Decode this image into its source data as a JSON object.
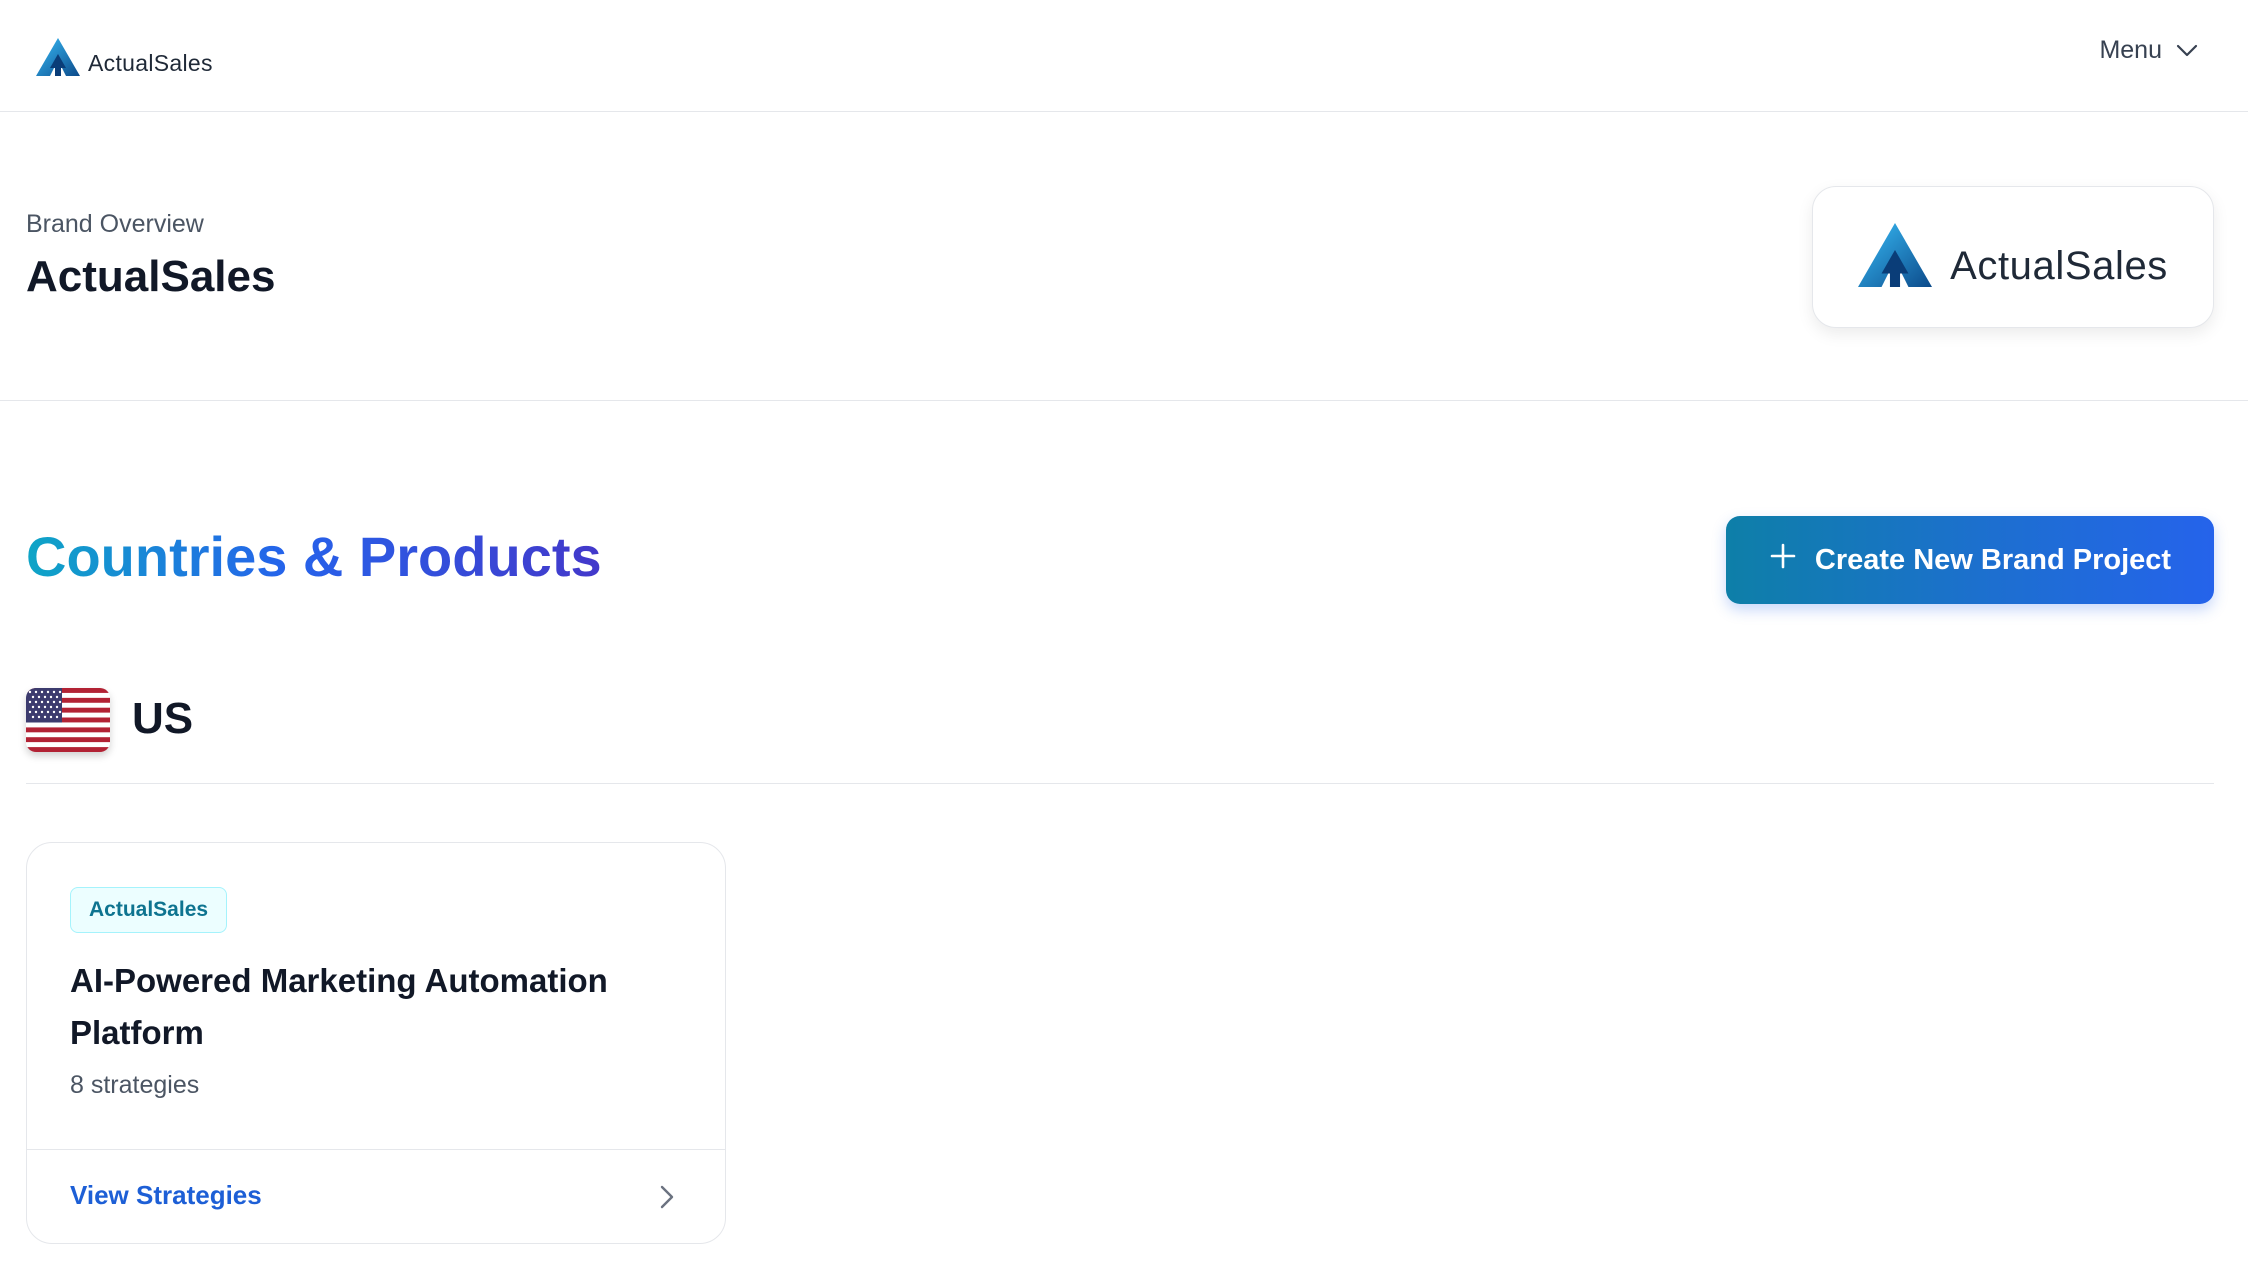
{
  "topnav": {
    "brand_name": "ActualSales",
    "menu_label": "Menu"
  },
  "header": {
    "breadcrumb": "Brand Overview",
    "title": "ActualSales",
    "logo_text": "ActualSales"
  },
  "main": {
    "section_title": "Countries & Products",
    "create_button_label": "Create New Brand Project",
    "countries": [
      {
        "code": "US",
        "flag_icon": "us-flag-icon",
        "products": [
          {
            "brand_badge": "ActualSales",
            "name": "AI-Powered Marketing Automation Platform",
            "strategies": "8 strategies",
            "link_label": "View Strategies"
          }
        ]
      }
    ]
  },
  "colors": {
    "accent_blue": "#2563eb",
    "accent_teal": "#0ea5c6",
    "badge_bg": "#ecfeff",
    "badge_text": "#0e7490"
  },
  "icons": [
    "actualsales-logo-icon",
    "chevron-down-icon",
    "plus-icon",
    "us-flag-icon",
    "chevron-right-icon"
  ]
}
